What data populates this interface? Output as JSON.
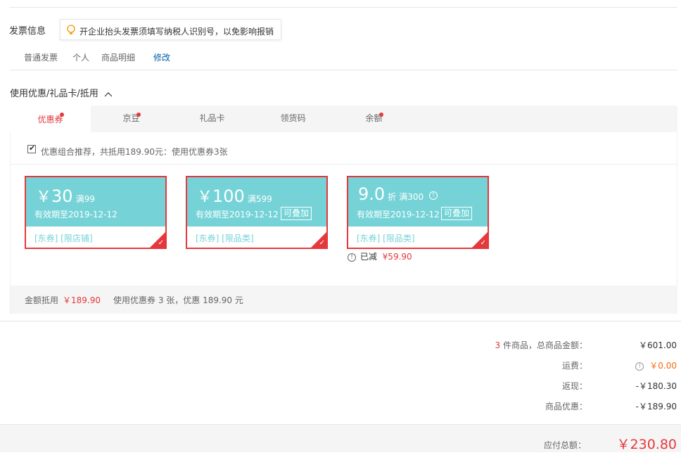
{
  "invoice": {
    "title": "发票信息",
    "tip": "开企业抬头发票须填写纳税人识别号，以免影响报销",
    "type": "普通发票",
    "header": "个人",
    "content": "商品明细",
    "edit": "修改"
  },
  "discount": {
    "title": "使用优惠/礼品卡/抵用",
    "tabs": [
      {
        "label": "优惠券"
      },
      {
        "label": "京豆"
      },
      {
        "label": "礼品卡"
      },
      {
        "label": "领货码"
      },
      {
        "label": "余额"
      }
    ],
    "recommend": "优惠组合推荐，共抵用189.90元：使用优惠券3张",
    "recommend_checked": true,
    "coupons": [
      {
        "symbol": "￥",
        "amount": "30",
        "condition": "满99",
        "valid": "有效期至2019-12-12",
        "stackable": "",
        "tags": "[东券]  [限店铺]"
      },
      {
        "symbol": "￥",
        "amount": "100",
        "condition": "满599",
        "valid": "有效期至2019-12-12",
        "stackable": "可叠加",
        "tags": "[东券]  [限品类]"
      },
      {
        "symbol": "",
        "amount": "9.0",
        "unit": "折",
        "condition": "满300",
        "valid": "有效期至2019-12-12",
        "stackable": "可叠加",
        "tags": "[东券]  [限品类]"
      }
    ],
    "reduced_label": "已减",
    "reduced_value": "¥59.90",
    "summary_label": "金额抵用",
    "summary_value": "￥189.90",
    "summary_text": "使用优惠券 3 张，优惠 189.90 元"
  },
  "totals": {
    "count": "3",
    "goods_label": "件商品，总商品金额：",
    "goods_value": "￥601.00",
    "freight_label": "运费：",
    "freight_value": "￥0.00",
    "cashback_label": "返现：",
    "cashback_value": "-￥180.30",
    "promo_label": "商品优惠：",
    "promo_value": "-￥189.90",
    "payable_label": "应付总额：",
    "payable_value": "￥230.80"
  },
  "colors": {
    "accent": "#e4393c",
    "coupon": "#75d3d7",
    "link": "#005ea7",
    "freight": "#f56c12"
  }
}
